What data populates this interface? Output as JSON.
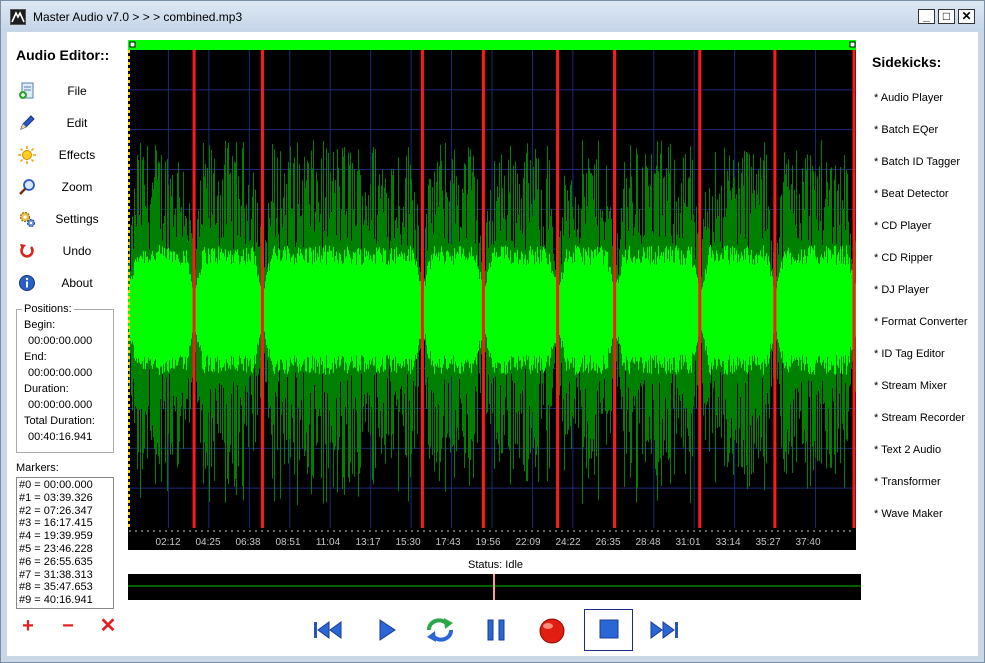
{
  "window": {
    "title": "Master Audio v7.0 > > > combined.mp3",
    "minimize": "_",
    "maximize": "□",
    "close": "✕"
  },
  "left_panel": {
    "title": "Audio Editor::",
    "menu": [
      {
        "label": "File",
        "icon": "file-add-icon"
      },
      {
        "label": "Edit",
        "icon": "pencil-icon"
      },
      {
        "label": "Effects",
        "icon": "sun-icon"
      },
      {
        "label": "Zoom",
        "icon": "magnifier-icon"
      },
      {
        "label": "Settings",
        "icon": "gears-icon"
      },
      {
        "label": "Undo",
        "icon": "undo-icon"
      },
      {
        "label": "About",
        "icon": "info-icon"
      }
    ],
    "positions": {
      "legend": "Positions:",
      "begin_label": "Begin:",
      "begin": "00:00:00.000",
      "end_label": "End:",
      "end": "00:00:00.000",
      "duration_label": "Duration:",
      "duration": "00:00:00.000",
      "total_label": "Total Duration:",
      "total": "00:40:16.941"
    },
    "markers_label": "Markers:",
    "markers": [
      "#0 = 00:00.000",
      "#1 = 03:39.326",
      "#2 = 07:26.347",
      "#3 = 16:17.415",
      "#4 = 19:39.959",
      "#5 = 23:46.228",
      "#6 = 26:55.635",
      "#7 = 31:38.313",
      "#8 = 35:47.653",
      "#9 = 40:16.941"
    ],
    "marker_buttons": {
      "add": "+",
      "remove": "−",
      "clear": "✕"
    }
  },
  "waveform": {
    "time_labels": [
      "02:12",
      "04:25",
      "06:38",
      "08:51",
      "11:04",
      "13:17",
      "15:30",
      "17:43",
      "19:56",
      "22:09",
      "24:22",
      "26:35",
      "28:48",
      "31:01",
      "33:14",
      "35:27",
      "37:40"
    ],
    "marker_seconds": [
      219.326,
      446.347,
      977.415,
      1179.959,
      1426.228,
      1615.635,
      1898.313,
      2147.653,
      2416.941
    ],
    "total_seconds": 2416.941,
    "colors": {
      "background": "#000000",
      "peak": "#008000",
      "rms": "#00ff00",
      "marker": "#ff1a1a",
      "grid": "#1a2a7a",
      "selection_bar": "#00ff00"
    }
  },
  "status": "Status: Idle",
  "playback": {
    "position_seconds": 0
  },
  "transport": [
    {
      "name": "rewind-to-start-button",
      "icon": "skip-back-icon"
    },
    {
      "name": "play-button",
      "icon": "play-icon"
    },
    {
      "name": "loop-button",
      "icon": "loop-icon"
    },
    {
      "name": "pause-button",
      "icon": "pause-icon"
    },
    {
      "name": "record-button",
      "icon": "record-icon"
    },
    {
      "name": "stop-button",
      "icon": "stop-icon"
    },
    {
      "name": "skip-to-end-button",
      "icon": "skip-forward-icon"
    }
  ],
  "sidekicks": {
    "title": "Sidekicks:",
    "items": [
      "* Audio Player",
      "* Batch EQer",
      "* Batch ID Tagger",
      "* Beat Detector",
      "* CD Player",
      "* CD Ripper",
      "* DJ Player",
      "* Format Converter",
      "* ID Tag Editor",
      "* Stream Mixer",
      "* Stream Recorder",
      "* Text 2 Audio",
      "* Transformer",
      "* Wave Maker"
    ]
  }
}
